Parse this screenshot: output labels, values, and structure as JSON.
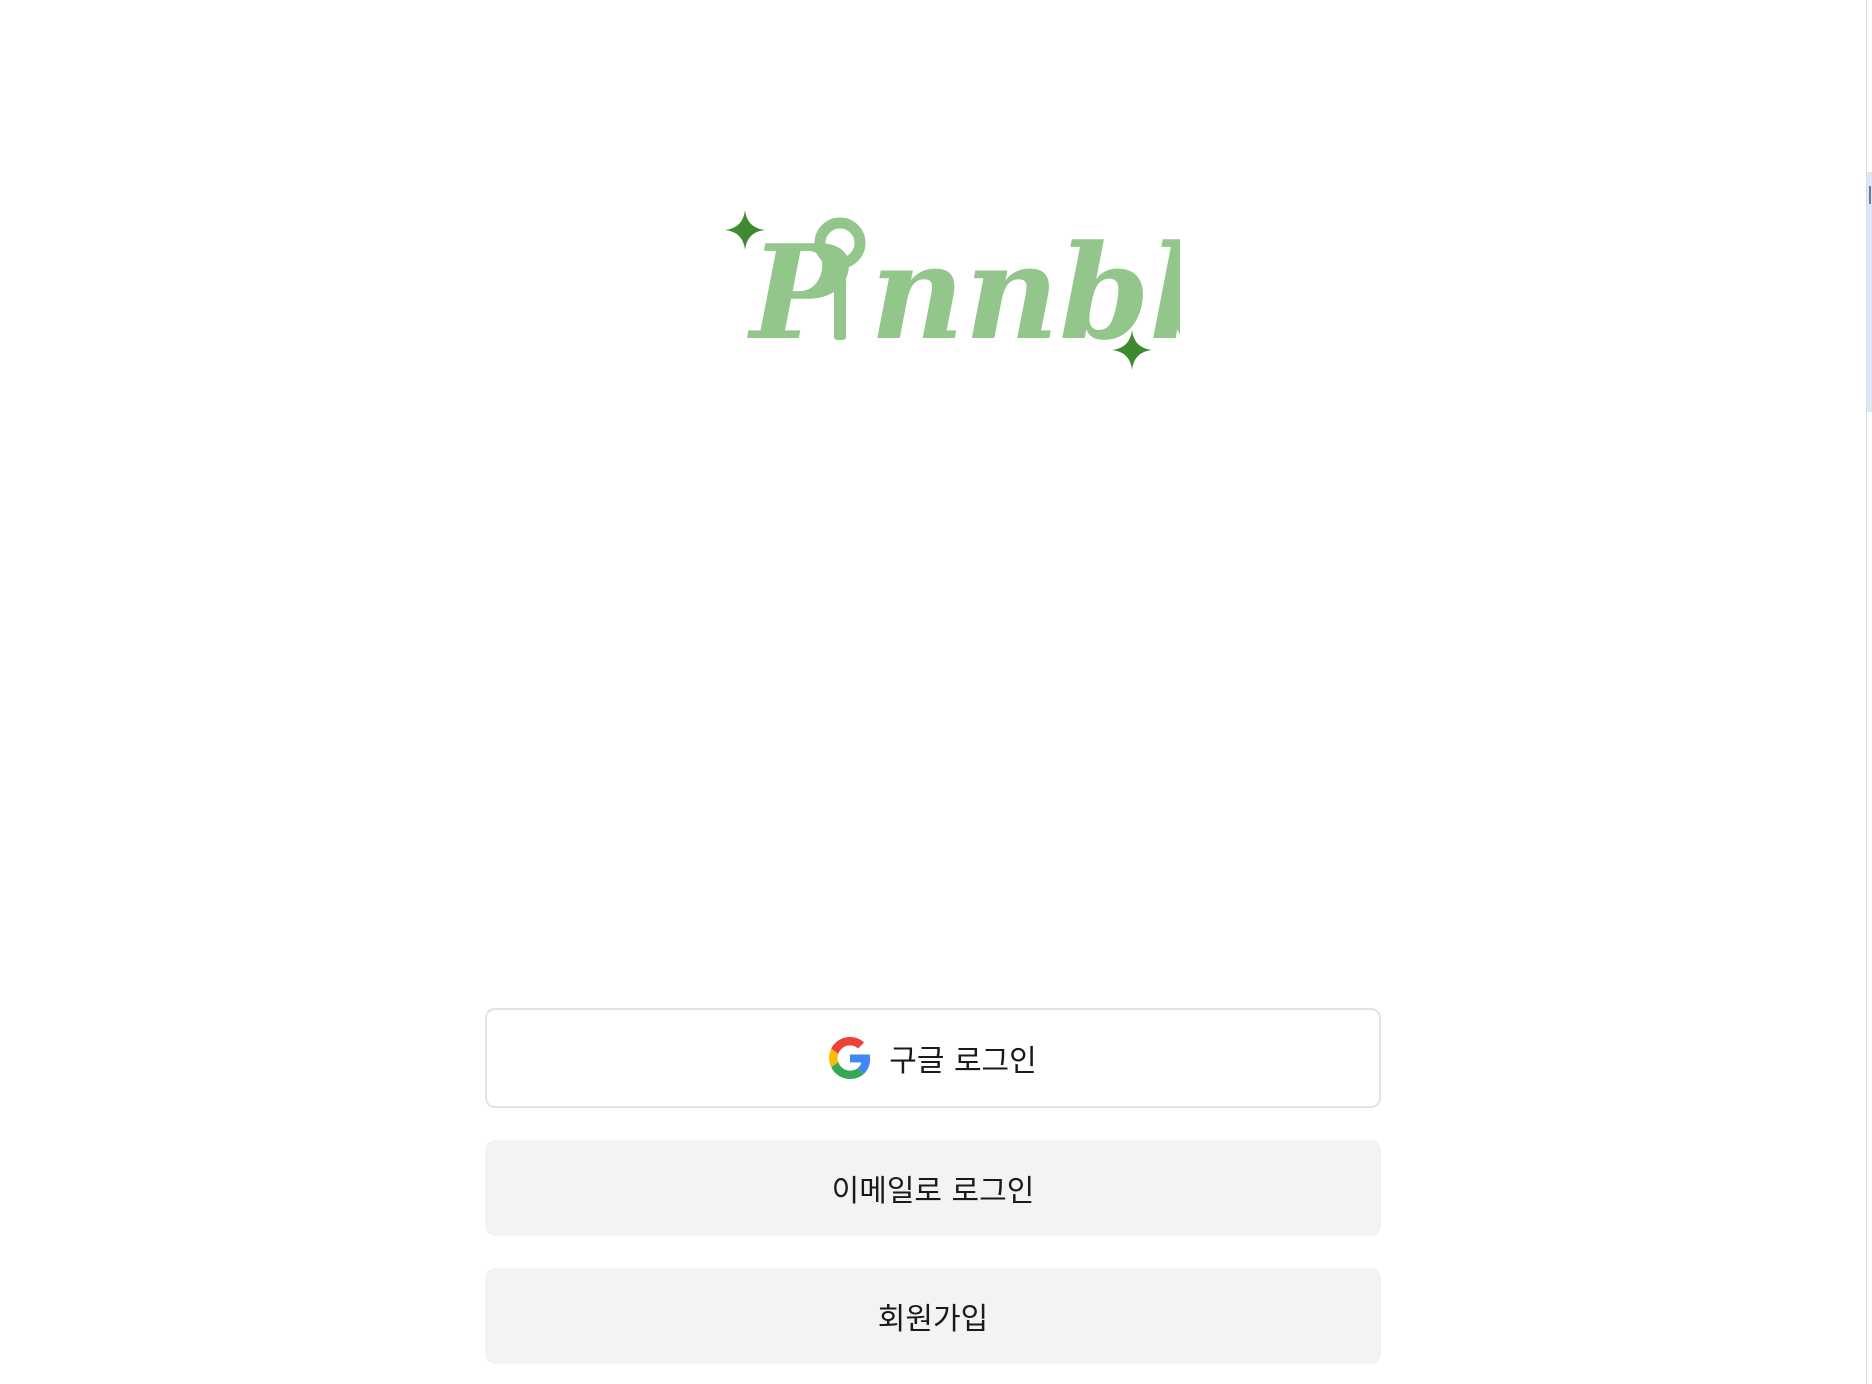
{
  "logo": {
    "text": "Pinnbb",
    "brand_color": "#92c68a",
    "sparkle_color": "#3e8a2f",
    "sparkle_icon": "sparkle-icon",
    "pin_icon": "map-pin-icon"
  },
  "auth": {
    "google_label": "구글 로그인",
    "google_icon": "google-icon",
    "email_label": "이메일로 로그인",
    "signup_label": "회원가입"
  }
}
